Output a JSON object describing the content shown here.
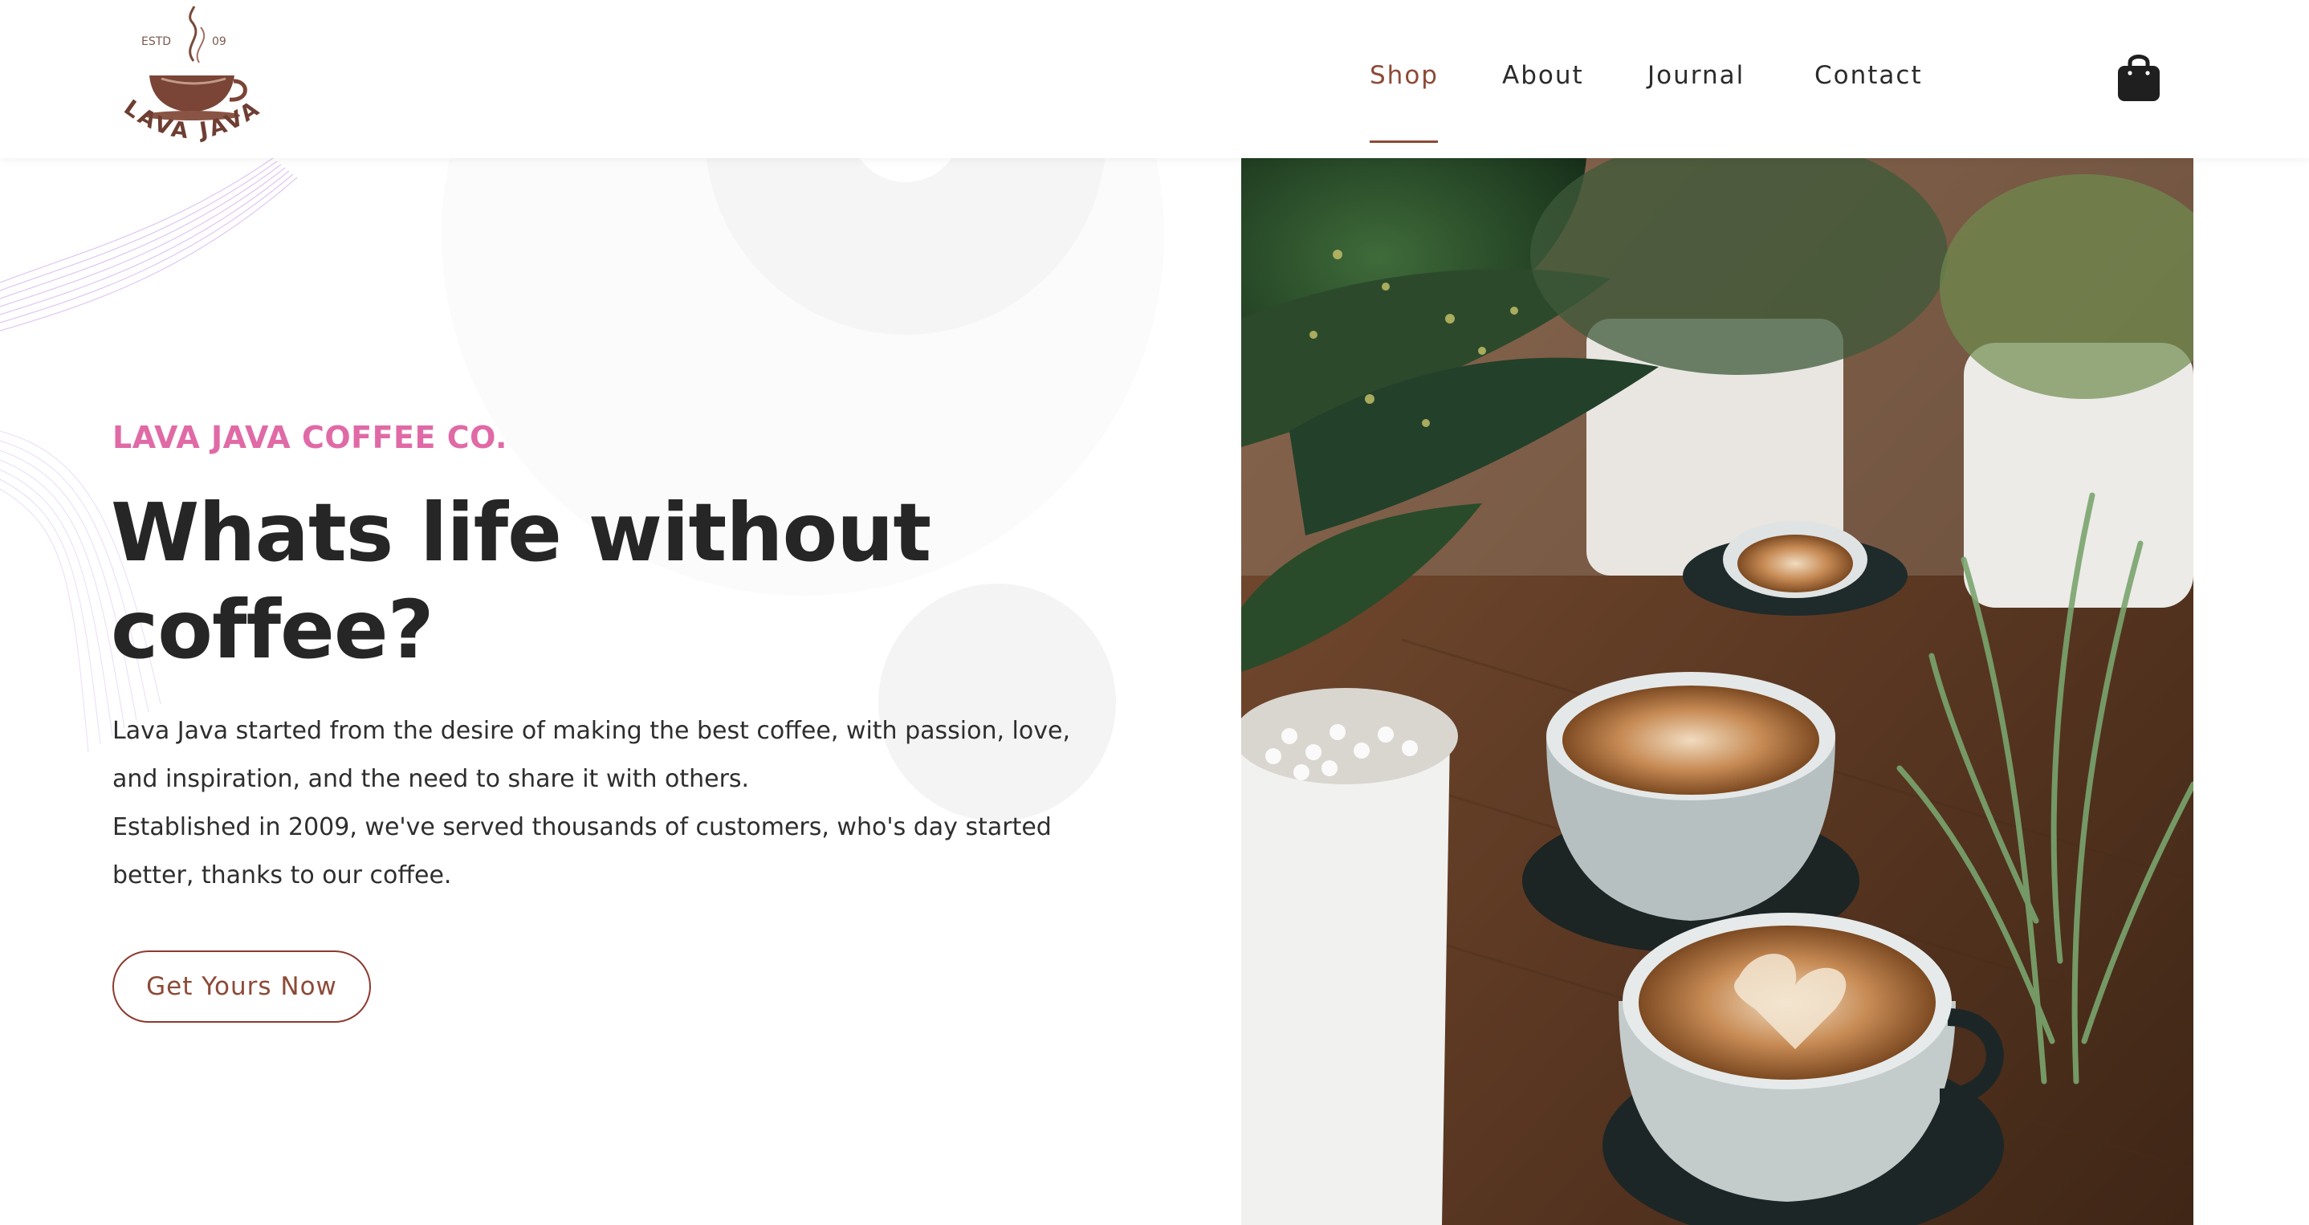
{
  "header": {
    "logo": {
      "estd": "ESTD",
      "year": "09",
      "name": "LAVA JAVA"
    },
    "nav": [
      {
        "label": "Shop",
        "active": true
      },
      {
        "label": "About",
        "active": false
      },
      {
        "label": "Journal",
        "active": false
      },
      {
        "label": "Contact",
        "active": false
      }
    ],
    "cart_icon": "shopping-bag-icon"
  },
  "hero": {
    "brand": "LAVA JAVA COFFEE CO.",
    "headline_line1": "Whats life without",
    "headline_line2": "coffee?",
    "paragraph_1": "Lava Java started from the desire of making the best coffee, with passion, love, and inspiration, and the need to share it with others.",
    "paragraph_2": "Established in 2009, we've served thousands of customers, who's day started better, thanks to our coffee.",
    "cta_label": "Get Yours Now",
    "image_alt": "latte-art-cups-with-plants-photo"
  },
  "colors": {
    "accent": "#8c4a36",
    "brand_pink": "#e06aa6",
    "heading": "#262626",
    "text": "#2e2e2e"
  }
}
